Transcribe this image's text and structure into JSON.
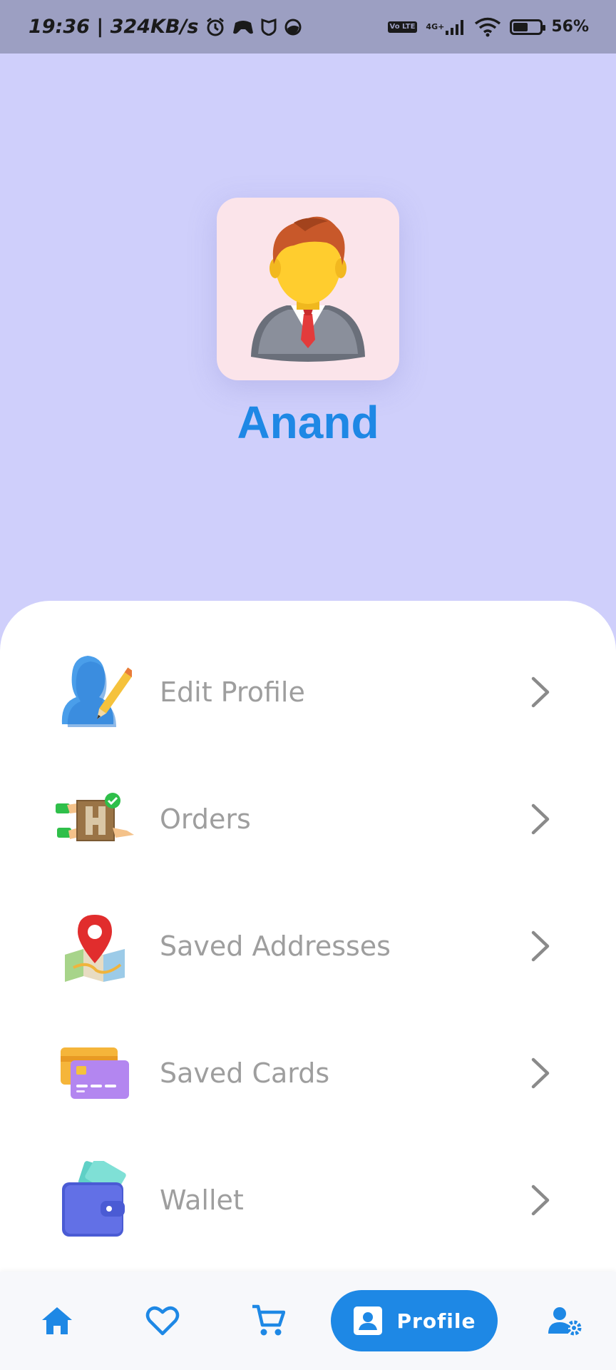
{
  "status_bar": {
    "time_speed": "19:36 | 324KB/s",
    "network_label": "4G+",
    "volte_label": "Vo LTE",
    "battery_percent": "56%",
    "battery_level": 0.56
  },
  "profile": {
    "name": "Anand",
    "avatar_icon": "businessman-avatar-icon"
  },
  "menu": {
    "items": [
      {
        "label": "Edit Profile",
        "icon": "edit-profile-icon"
      },
      {
        "label": "Orders",
        "icon": "orders-box-icon"
      },
      {
        "label": "Saved Addresses",
        "icon": "map-pin-icon"
      },
      {
        "label": "Saved Cards",
        "icon": "credit-card-icon"
      },
      {
        "label": "Wallet",
        "icon": "wallet-icon"
      }
    ]
  },
  "bottom_nav": {
    "items": [
      {
        "icon": "home-icon"
      },
      {
        "icon": "heart-icon"
      },
      {
        "icon": "cart-icon"
      },
      {
        "icon": "profile-icon",
        "label": "Profile",
        "active": true
      },
      {
        "icon": "user-settings-icon"
      }
    ]
  },
  "colors": {
    "accent": "#1e88e5",
    "header_bg": "#cfcffb",
    "status_bar_bg": "#9c9fc2",
    "label_gray": "#9e9e9e"
  }
}
